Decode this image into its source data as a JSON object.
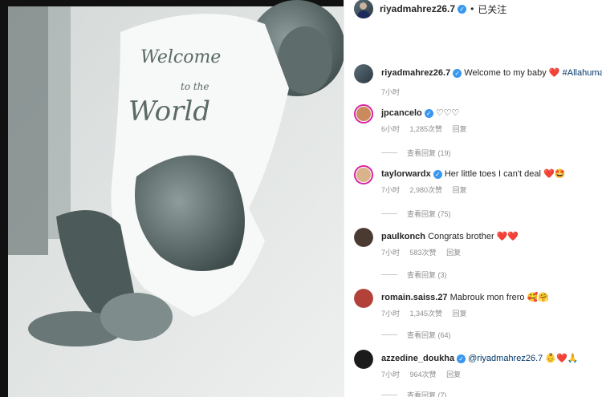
{
  "post_header": {
    "username": "riyadmahrez26.7",
    "separator": "•",
    "follow_status": "已关注"
  },
  "caption": {
    "username": "riyadmahrez26.7",
    "text": "Welcome to my baby",
    "emoji": "❤️",
    "hashtag": "#Allahumabarik",
    "time": "7小时"
  },
  "comments": [
    {
      "username": "jpcancelo",
      "text": "♡♡♡",
      "time": "6小时",
      "likes": "1,285次赞",
      "reply_label": "回复",
      "view_replies": "查看回复 (19)",
      "avatar_color": "#c98a5c"
    },
    {
      "username": "taylorwardx",
      "text": "Her little toes I can't deal",
      "emoji": "❤️🤩",
      "time": "7小时",
      "likes": "2,980次赞",
      "reply_label": "回复",
      "view_replies": "查看回复 (75)",
      "avatar_color": "#d9b48a"
    },
    {
      "username": "paulkonch",
      "text": "Congrats brother",
      "emoji": "❤️❤️",
      "time": "7小时",
      "likes": "583次赞",
      "reply_label": "回复",
      "view_replies": "查看回复 (3)",
      "avatar_color": "#4a3a32"
    },
    {
      "username": "romain.saiss.27",
      "text": "Mabrouk mon frero",
      "emoji": "🥰🤗",
      "time": "7小时",
      "likes": "1,345次赞",
      "reply_label": "回复",
      "view_replies": "查看回复 (64)",
      "avatar_color": "#b2413a"
    },
    {
      "username": "azzedine_doukha",
      "mention": "@riyadmahrez26.7",
      "emoji": "👶❤️🙏",
      "time": "7小时",
      "likes": "964次赞",
      "reply_label": "回复",
      "view_replies": "查看回复 (7)",
      "avatar_color": "#1b1b1b"
    }
  ],
  "photo": {
    "onesie_text_1": "Welcome",
    "onesie_text_2": "to the",
    "onesie_text_3": "World"
  }
}
